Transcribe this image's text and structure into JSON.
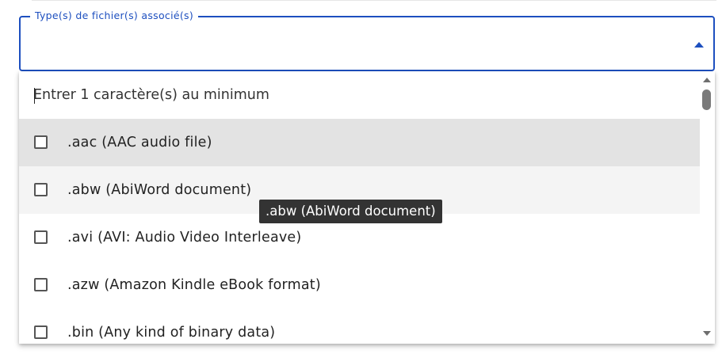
{
  "field": {
    "label": "Type(s) de fichier(s) associé(s)",
    "value": ""
  },
  "dropdown": {
    "search_placeholder": "Entrer 1 caractère(s) au minimum",
    "options": [
      {
        "label": ".aac (AAC audio file)",
        "checked": false,
        "state": "active"
      },
      {
        "label": ".abw (AbiWord document)",
        "checked": false,
        "state": "hover"
      },
      {
        "label": ".avi (AVI: Audio Video Interleave)",
        "checked": false,
        "state": "normal"
      },
      {
        "label": ".azw (Amazon Kindle eBook format)",
        "checked": false,
        "state": "normal"
      },
      {
        "label": ".bin (Any kind of binary data)",
        "checked": false,
        "state": "normal"
      }
    ]
  },
  "tooltip": {
    "text": ".abw (AbiWord document)"
  },
  "icons": {
    "field_toggle": "caret-up-icon",
    "scroll_up": "scroll-up-arrow-icon",
    "scroll_down": "scroll-down-arrow-icon"
  },
  "colors": {
    "accent": "#1d4fbf",
    "active_option_bg": "#e3e3e3",
    "hover_option_bg": "#f4f4f4",
    "tooltip_bg": "#333333"
  }
}
